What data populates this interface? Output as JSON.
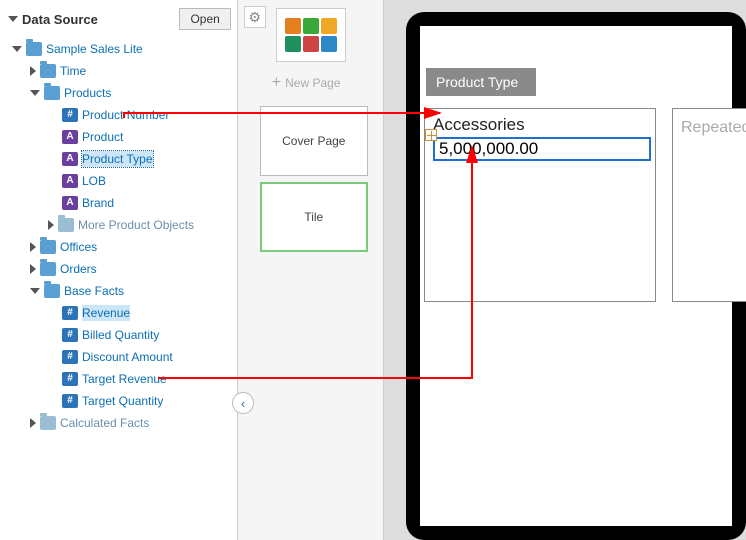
{
  "sidebar": {
    "title": "Data Source",
    "open_label": "Open",
    "root": "Sample Sales Lite",
    "time": "Time",
    "products": "Products",
    "product_number": "Product Number",
    "product": "Product",
    "product_type": "Product Type",
    "lob": "LOB",
    "brand": "Brand",
    "more_product_objects": "More Product Objects",
    "offices": "Offices",
    "orders": "Orders",
    "base_facts": "Base Facts",
    "revenue": "Revenue",
    "billed_qty": "Billed Quantity",
    "discount": "Discount Amount",
    "target_rev": "Target Revenue",
    "target_qty": "Target Quantity",
    "calc_facts": "Calculated Facts"
  },
  "middle": {
    "new_page": "New Page",
    "cover": "Cover Page",
    "tile": "Tile"
  },
  "canvas": {
    "badge": "Product Type",
    "tile_title": "Accessories",
    "tile_value": "5,000,000.00",
    "repeated": "Repeated"
  }
}
